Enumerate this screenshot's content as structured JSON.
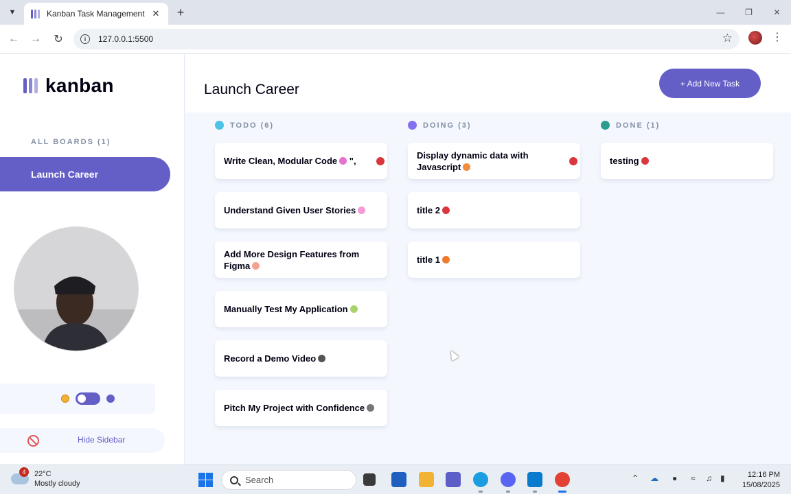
{
  "browser": {
    "tab_title": "Kanban Task Management",
    "url": "127.0.0.1:5500"
  },
  "sidebar": {
    "logo_text": "kanban",
    "boards_heading": "ALL BOARDS (1)",
    "boards": [
      {
        "label": "Launch Career",
        "active": true
      }
    ],
    "hide_label": "Hide Sidebar"
  },
  "header": {
    "title": "Launch Career",
    "add_task_label": "+ Add New Task"
  },
  "columns": [
    {
      "name": "TODO (6)",
      "color": "#49c4e5",
      "cards": [
        {
          "title": "Write Clean, Modular Code",
          "suffix": "\",",
          "emoji_color": "#e66fd2",
          "flag": true
        },
        {
          "title": "Understand Given User Stories",
          "emoji_color": "#f29bd4"
        },
        {
          "title": "Add More Design Features from Figma",
          "emoji_color": "#f2a28e"
        },
        {
          "title": "Manually Test My Application",
          "emoji_color": "#a7d36a"
        },
        {
          "title": "Record a Demo Video",
          "emoji_color": "#555555"
        },
        {
          "title": "Pitch My Project with Confidence",
          "emoji_color": "#777777"
        }
      ]
    },
    {
      "name": "DOING (3)",
      "color": "#8471f2",
      "cards": [
        {
          "title": "Display dynamic data with Javascript",
          "emoji_color": "#f08c3a",
          "flag": true
        },
        {
          "title": "title 2",
          "emoji_color": "#d9363e"
        },
        {
          "title": "title 1",
          "emoji_color": "#f07a2a"
        }
      ]
    },
    {
      "name": "DONE (1)",
      "color": "#2a9d8f",
      "cards": [
        {
          "title": "testing",
          "emoji_color": "#d9363e"
        }
      ]
    }
  ],
  "taskbar": {
    "weather_temp": "22°C",
    "weather_desc": "Mostly cloudy",
    "weather_badge": "4",
    "search_label": "Search",
    "time": "12:16 PM",
    "date": "15/08/2025"
  }
}
